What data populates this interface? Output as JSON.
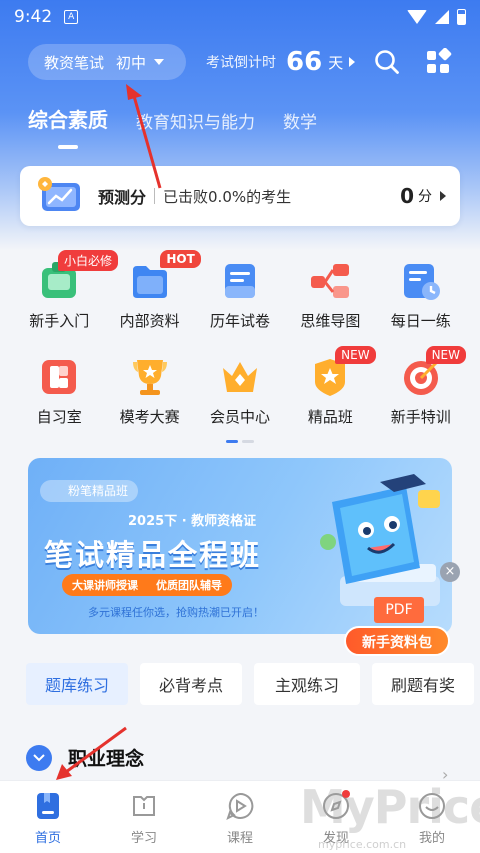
{
  "status_bar": {
    "time": "9:42",
    "notif": "A"
  },
  "top": {
    "exam_type": "教资笔试",
    "exam_level": "初中",
    "countdown_label": "考试倒计时",
    "countdown_days": "66",
    "countdown_unit": "天"
  },
  "tabs": [
    {
      "label": "综合素质",
      "active": true
    },
    {
      "label": "教育知识与能力",
      "active": false
    },
    {
      "label": "数学",
      "active": false
    }
  ],
  "predict": {
    "title": "预测分",
    "desc": "已击败0.0%的考生",
    "score": "0",
    "unit": "分"
  },
  "grid": [
    {
      "label": "新手入门",
      "icon": "beginner-icon",
      "badge": "小白必修"
    },
    {
      "label": "内部资料",
      "icon": "folder-icon",
      "badge": "HOT"
    },
    {
      "label": "历年试卷",
      "icon": "paper-icon"
    },
    {
      "label": "思维导图",
      "icon": "mindmap-icon"
    },
    {
      "label": "每日一练",
      "icon": "daily-icon"
    },
    {
      "label": "自习室",
      "icon": "study-room-icon"
    },
    {
      "label": "模考大赛",
      "icon": "trophy-icon"
    },
    {
      "label": "会员中心",
      "icon": "crown-icon"
    },
    {
      "label": "精品班",
      "icon": "star-shield-icon",
      "badge": "NEW"
    },
    {
      "label": "新手特训",
      "icon": "target-icon",
      "badge": "NEW"
    }
  ],
  "banner": {
    "tag": "粉笔精品班",
    "subtitle": "2025下 · 教师资格证",
    "title": "笔试精品全程班",
    "chips": [
      "大课讲师授课",
      "优质团队辅导"
    ],
    "footer": "多元课程任你选，抢购热潮已开启！",
    "pdf": "PDF",
    "close": "×"
  },
  "newbie_pack": "新手资料包",
  "segments": [
    {
      "label": "题库练习",
      "active": true
    },
    {
      "label": "必背考点",
      "active": false
    },
    {
      "label": "主观练习",
      "active": false
    },
    {
      "label": "刷题有奖",
      "active": false
    }
  ],
  "section": {
    "title": "职业理念",
    "more": "›"
  },
  "tab_bar": [
    {
      "label": "首页",
      "icon": "home-book-icon",
      "active": true
    },
    {
      "label": "学习",
      "icon": "study-icon",
      "active": false
    },
    {
      "label": "课程",
      "icon": "play-course-icon",
      "active": false
    },
    {
      "label": "发现",
      "icon": "discover-icon",
      "active": false,
      "dot": true
    },
    {
      "label": "我的",
      "icon": "profile-icon",
      "active": false
    }
  ],
  "watermark": {
    "main": "MyPrice",
    "sub": "myprice.com.cn"
  },
  "colors": {
    "primary": "#3d7bf0",
    "accent_red": "#f03c3c",
    "orange": "#ff7a1a"
  }
}
